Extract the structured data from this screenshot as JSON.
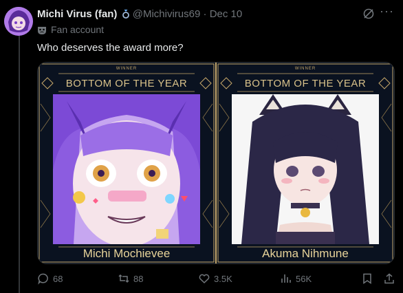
{
  "post": {
    "display_name": "Michi Virus (fan)",
    "handle": "@Michivirus69",
    "separator": "·",
    "date": "Dec 10",
    "label": "Fan account",
    "text": "Who deserves the award more?"
  },
  "media": {
    "left": {
      "winner_text": "WINNER",
      "banner": "BOTTOM OF THE YEAR",
      "name": "Michi Mochievee"
    },
    "right": {
      "winner_text": "WINNER",
      "banner": "BOTTOM OF THE YEAR",
      "name": "Akuma Nihmune"
    }
  },
  "actions": {
    "replies": "68",
    "reposts": "88",
    "likes": "3.5K",
    "views": "56K"
  },
  "colors": {
    "background": "#000000",
    "text": "#e7e9ea",
    "muted": "#71767b",
    "gold": "#c8a96b",
    "panel_bg": "#0a1220"
  },
  "icons": [
    "avatar",
    "ring-icon",
    "grok-icon",
    "more-icon",
    "mask-icon",
    "reply-icon",
    "repost-icon",
    "like-icon",
    "views-icon",
    "bookmark-icon",
    "share-icon"
  ]
}
